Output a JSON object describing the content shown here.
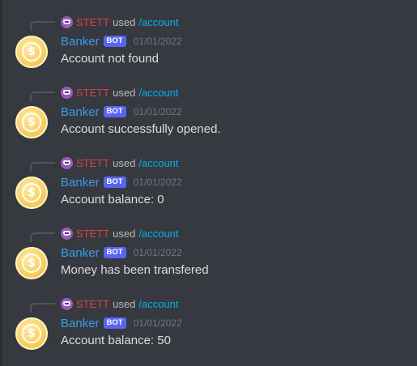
{
  "messages": [
    {
      "reply": {
        "user": "STETT",
        "used": "used",
        "command": "/account"
      },
      "author": "Banker",
      "bot_tag": "BOT",
      "timestamp": "01/01/2022",
      "content": "Account not found"
    },
    {
      "reply": {
        "user": "STETT",
        "used": "used",
        "command": "/account"
      },
      "author": "Banker",
      "bot_tag": "BOT",
      "timestamp": "01/01/2022",
      "content": "Account successfully opened."
    },
    {
      "reply": {
        "user": "STETT",
        "used": "used",
        "command": "/account"
      },
      "author": "Banker",
      "bot_tag": "BOT",
      "timestamp": "01/01/2022",
      "content": "Account balance: 0"
    },
    {
      "reply": {
        "user": "STETT",
        "used": "used",
        "command": "/account"
      },
      "author": "Banker",
      "bot_tag": "BOT",
      "timestamp": "01/01/2022",
      "content": "Money has been transfered"
    },
    {
      "reply": {
        "user": "STETT",
        "used": "used",
        "command": "/account"
      },
      "author": "Banker",
      "bot_tag": "BOT",
      "timestamp": "01/01/2022",
      "content": "Account balance: 50"
    }
  ],
  "avatar_icon": "dollar-coin-icon",
  "colors": {
    "background": "#36393f",
    "username": "#3a9ce8",
    "bot_tag": "#5865f2",
    "reply_user": "#ed4245",
    "command": "#00aff4",
    "coin": "#f7cf62"
  }
}
